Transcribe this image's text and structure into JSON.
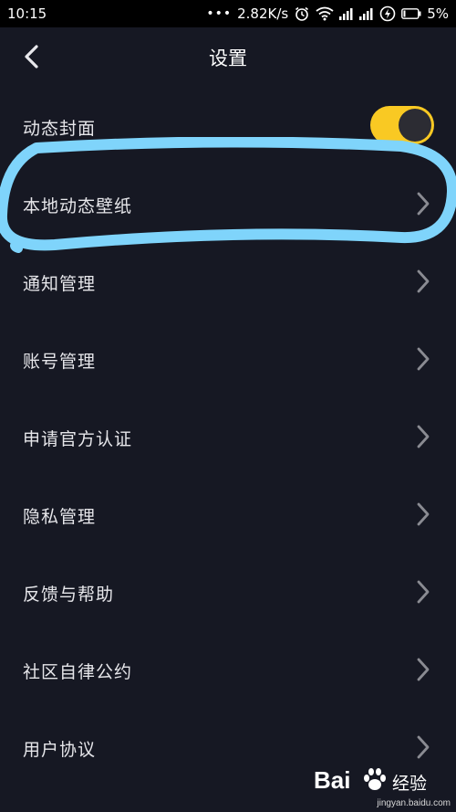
{
  "status_bar": {
    "time": "10:15",
    "dots": "•••",
    "speed": "2.82K/s",
    "battery": "5%"
  },
  "header": {
    "title": "设置"
  },
  "settings": {
    "dynamic_cover": {
      "label": "动态封面",
      "toggle_on": true
    },
    "items": [
      {
        "label": "本地动态壁纸"
      },
      {
        "label": "通知管理"
      },
      {
        "label": "账号管理"
      },
      {
        "label": "申请官方认证"
      },
      {
        "label": "隐私管理"
      },
      {
        "label": "反馈与帮助"
      },
      {
        "label": "社区自律公约"
      },
      {
        "label": "用户协议"
      }
    ]
  },
  "watermark": {
    "logo": "Bai",
    "text": "经验",
    "url": "jingyan.baidu.com"
  },
  "colors": {
    "background": "#161823",
    "toggle_track": "#f9c923",
    "toggle_knob": "#2c2c33",
    "highlight_stroke": "#7fd4fb",
    "chevron": "#8a8b92"
  },
  "icons": {
    "back": "chevron-left-icon",
    "row_arrow": "chevron-right-icon",
    "status": [
      "alarm-icon",
      "wifi-icon",
      "signal-icon",
      "charging-icon",
      "battery-icon"
    ]
  }
}
